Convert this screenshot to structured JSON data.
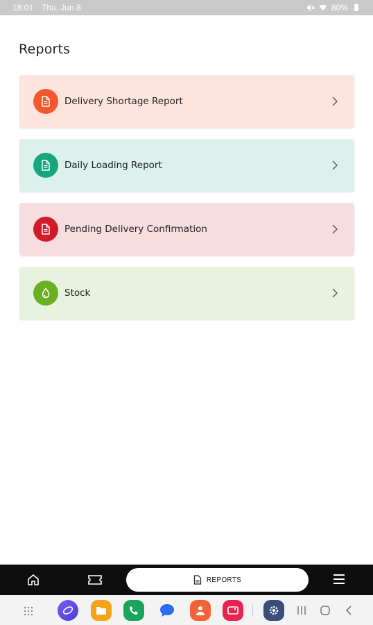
{
  "status_bar": {
    "time": "18:01",
    "date": "Thu, Jun 8",
    "battery": "80%",
    "icons": [
      "mute-icon",
      "wifi-icon",
      "battery-icon"
    ]
  },
  "page": {
    "title": "Reports"
  },
  "reports": [
    {
      "label": "Delivery Shortage Report",
      "icon": "document-icon",
      "bg": "#fde4df",
      "badge": "#f2582e"
    },
    {
      "label": "Daily Loading Report",
      "icon": "document-icon",
      "bg": "#dcf1ec",
      "badge": "#16a77f"
    },
    {
      "label": "Pending Delivery Confirmation",
      "icon": "document-icon",
      "bg": "#f8dde0",
      "badge": "#d21b2a"
    },
    {
      "label": "Stock",
      "icon": "droplet-icon",
      "bg": "#e7f2df",
      "badge": "#6ab023"
    }
  ],
  "bottom_nav": {
    "active_label": "REPORTS",
    "items": [
      "home-icon",
      "ticket-icon",
      "reports-icon",
      "menu-icon"
    ]
  },
  "dock": {
    "apps": [
      "apps-grid-icon",
      "internet-icon",
      "files-icon",
      "phone-icon",
      "messages-icon",
      "contacts-icon",
      "gallery-icon",
      "settings-icon"
    ],
    "system": [
      "recents-icon",
      "home-circle-icon",
      "back-icon"
    ]
  }
}
